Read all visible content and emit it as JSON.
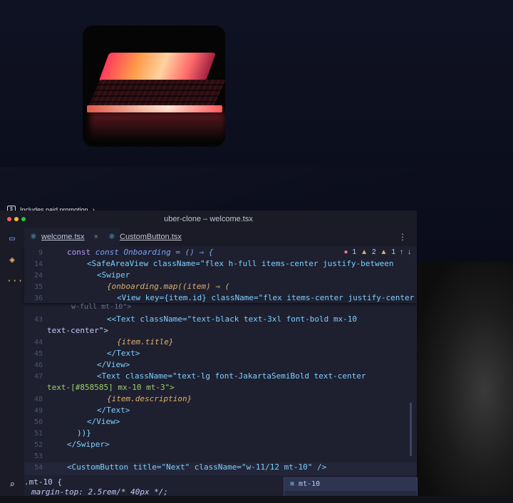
{
  "promo": {
    "label": "Includes paid promotion"
  },
  "window": {
    "title": "uber-clone – welcome.tsx"
  },
  "tabs": [
    {
      "label": "welcome.tsx",
      "close": "×"
    },
    {
      "label": "CustomButton.tsx"
    }
  ],
  "diagnostics": {
    "errors": "1",
    "warnings": "2",
    "info": "1"
  },
  "code_lines": [
    {
      "n": "9"
    },
    {
      "n": "14"
    },
    {
      "n": "24"
    },
    {
      "n": "35"
    },
    {
      "n": "36"
    },
    {
      "n": "43"
    },
    {
      "n": "44"
    },
    {
      "n": "45"
    },
    {
      "n": "46"
    },
    {
      "n": "47"
    },
    {
      "n": "48"
    },
    {
      "n": "49"
    },
    {
      "n": "50"
    },
    {
      "n": "51"
    },
    {
      "n": "52"
    },
    {
      "n": "53"
    },
    {
      "n": "54"
    }
  ],
  "code_text": {
    "l9": "const Onboarding = () ⇒ {",
    "l14": "<SafeAreaView className=\"flex h-full items-center justify-between",
    "l24": "<Swiper",
    "l35": "{onboarding.map((item) ⇒ (",
    "l36": "<View key={item.id} className=\"flex items-center justify-center",
    "wrap36": "w-full mt-10\">",
    "l43": "<Text className=\"text-black text-3xl font-bold mx-10",
    "wrap43": "text-center\">",
    "l44": "{item.title}",
    "l45": "</Text>",
    "l46": "</View>",
    "l47": "<Text className=\"text-lg font-JakartaSemiBold text-center",
    "wrap47": "text-[#858585] mx-10 mt-3\">",
    "l48": "{item.description}",
    "l49": "</Text>",
    "l50": "</View>",
    "l51": "))}",
    "l52": "</Swiper>",
    "l53": "",
    "l54": "<CustomButton title=\"Next\" className=\"w-11/12 mt-10\" />",
    "css1": ".mt-10 {",
    "css2": "margin-top: 2.5rem/* 40px */;"
  },
  "suggestions": [
    {
      "label": "mt-10"
    },
    {
      "label": "mt-10"
    }
  ],
  "colors": {
    "accent": "#7aa2f7",
    "error": "#f7768e",
    "warning": "#e0af68"
  }
}
